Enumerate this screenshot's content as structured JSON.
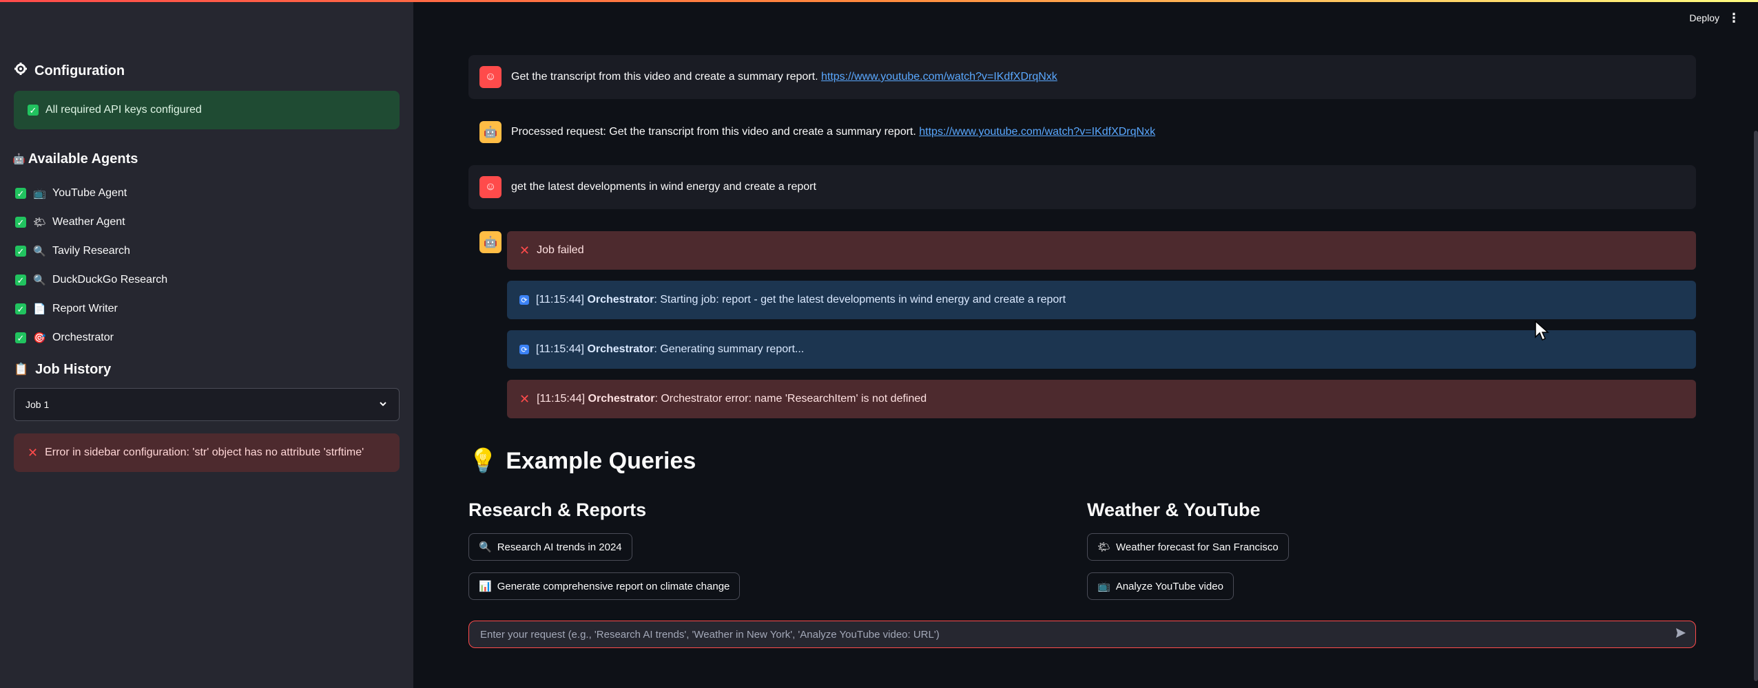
{
  "sidebar": {
    "config_title": "Configuration",
    "config_icon": "gear-icon",
    "api_status": "All required API keys configured",
    "agents_title": "Available Agents",
    "agents_icon": "robot-icon",
    "agents": [
      {
        "label": "YouTube Agent",
        "icon": "📺"
      },
      {
        "label": "Weather Agent",
        "icon": "🌤"
      },
      {
        "label": "Tavily Research",
        "icon": "🔍"
      },
      {
        "label": "DuckDuckGo Research",
        "icon": "🔍"
      },
      {
        "label": "Report Writer",
        "icon": "📄"
      },
      {
        "label": "Orchestrator",
        "icon": "🎯"
      }
    ],
    "history_title": "Job History",
    "history_icon": "clipboard-icon",
    "job_select_value": "Job 1",
    "error_text": "Error in sidebar configuration: 'str' object has no attribute 'strftime'"
  },
  "header": {
    "deploy_label": "Deploy",
    "menu_icon": "⋮"
  },
  "messages": [
    {
      "role": "user",
      "text": "Get the transcript from this video and create a summary report. ",
      "link": "https://www.youtube.com/watch?v=IKdfXDrqNxk"
    },
    {
      "role": "assistant",
      "text": "Processed request: Get the transcript from this video and create a summary report. ",
      "link": "https://www.youtube.com/watch?v=IKdfXDrqNxk"
    },
    {
      "role": "user",
      "text": "get the latest developments in wind energy and create a report"
    }
  ],
  "job": {
    "status": "Job failed",
    "logs": [
      {
        "time": "[11:15:44]",
        "agent": "Orchestrator",
        "text": ": Starting job: report - get the latest developments in wind energy and create a report",
        "kind": "info"
      },
      {
        "time": "[11:15:44]",
        "agent": "Orchestrator",
        "text": ": Generating summary report...",
        "kind": "info"
      },
      {
        "time": "[11:15:44]",
        "agent": "Orchestrator",
        "text": ": Orchestrator error: name 'ResearchItem' is not defined",
        "kind": "error"
      }
    ]
  },
  "examples": {
    "title": "Example Queries",
    "title_icon": "💡",
    "left_title": "Research & Reports",
    "right_title": "Weather & YouTube",
    "left_buttons": [
      {
        "icon": "🔍",
        "label": "Research AI trends in 2024"
      },
      {
        "icon": "📊",
        "label": "Generate comprehensive report on climate change"
      }
    ],
    "right_buttons": [
      {
        "icon": "🌤",
        "label": "Weather forecast for San Francisco"
      },
      {
        "icon": "📺",
        "label": "Analyze YouTube video"
      }
    ]
  },
  "chat_input": {
    "placeholder": "Enter your request (e.g., 'Research AI trends', 'Weather in New York', 'Analyze YouTube video: URL')"
  },
  "colors": {
    "accent": "#ff4b4b",
    "success_bg": "#1f4b33",
    "error_bg": "#4d2a2e",
    "info_bg": "#1c3550"
  }
}
